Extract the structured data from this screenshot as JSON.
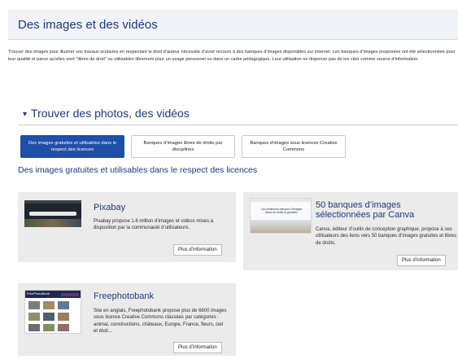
{
  "page_title": "Des images et des vidéos",
  "intro": "Trouver des images pour illustrer vos travaux scolaires en respectant le droit d’auteur nécessite d’avoir recours à des banques d’images disponibles sur internet. Les banques d’images proposées ont été sélectionnées pour leur qualité et parce qu’elles sont \"libres de droit\" ou utilisables librement pour un usage personnel ou dans un cadre pédagogique. Leur utilisation ne dispense pas de les citer comme source d’information.",
  "section": {
    "heading": "Trouver des photos, des vidéos",
    "caret": "▾"
  },
  "tabs": [
    {
      "label": "Des images gratuites et utilisables dans le respect des licences"
    },
    {
      "label": "Banques d’images libres de droits par disciplines"
    },
    {
      "label": "Banques d’images sous licences Creative Commons"
    }
  ],
  "sub_heading": "Des images gratuites et utilisables dans le respect des licences",
  "cards": [
    {
      "title": "Pixabay",
      "description": "Pixabay propose 1.6 million d’images et vidéos mises à disposition par la communauté d’utilisateurs.",
      "button": "Plus d’information"
    },
    {
      "title": "50 banques d’images sélectionnées par Canva",
      "description": "Canva, éditeur d’outils de conception graphique, propose à ses utilisateurs des liens vers 50 banques d’images gratuites et libres de droits.",
      "button": "Plus d’information",
      "thumb_heading": "Les meilleures banques d’images libres de droits et gratuites"
    },
    {
      "title": "Freephotobank",
      "description": "Site en anglais, Freephotobank propose plus de 6600 images sous licence Creative Commons classées par catégories : animal, constructions, châteaux, Europe, France, fleurs, ciel et étoil…",
      "button": "Plus d’information",
      "thumb_brand": "FreePhotoBank"
    }
  ],
  "colors": {
    "title_blue": "#1e3a7a",
    "tab_active": "#1f4fa6",
    "card_bg": "#ebebeb"
  }
}
